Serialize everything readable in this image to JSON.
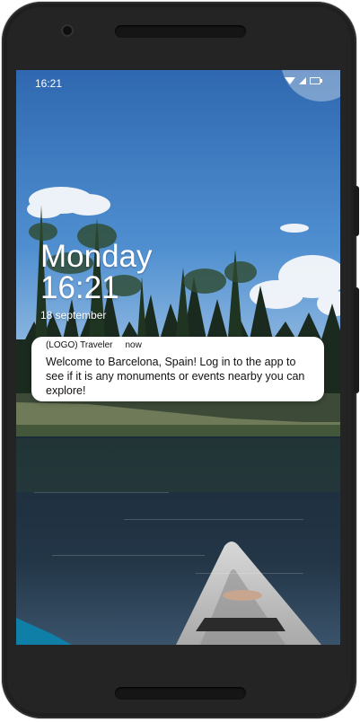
{
  "status_bar": {
    "time": "16:21",
    "icons": [
      "wifi-icon",
      "signal-icon",
      "battery-icon"
    ]
  },
  "lock_screen": {
    "day": "Monday",
    "time": "16:21",
    "date": "18 september"
  },
  "notification": {
    "app": "(LOGO) Traveler",
    "when": "now",
    "message": "Welcome to Barcelona, Spain! Log in to the app to see if it is any monuments or events nearby you can explore!"
  },
  "colors": {
    "sky": "#3f7fc0",
    "water": "#223444",
    "notification_bg": "#ffffff",
    "phone": "#1f1f1f"
  }
}
